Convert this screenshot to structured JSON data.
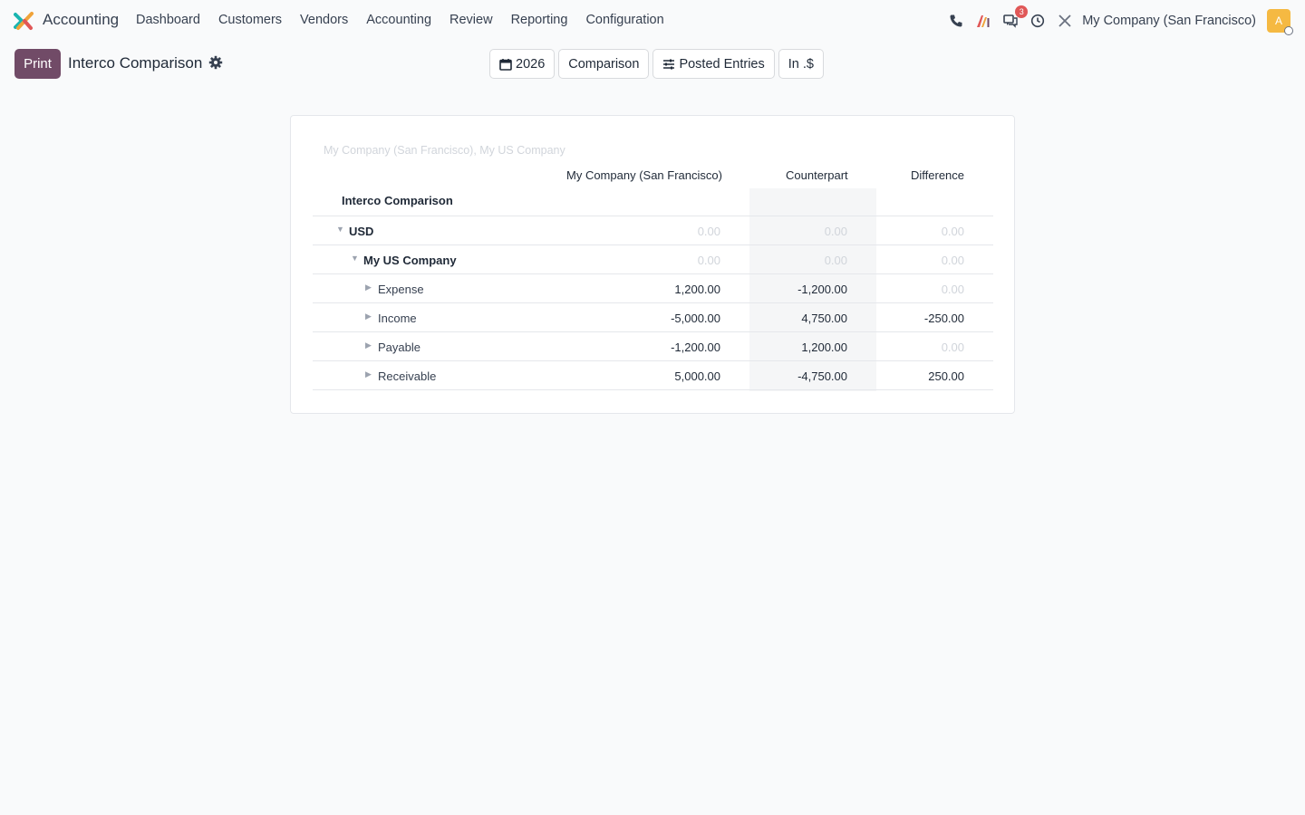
{
  "navbar": {
    "app_name": "Accounting",
    "menu": [
      "Dashboard",
      "Customers",
      "Vendors",
      "Accounting",
      "Review",
      "Reporting",
      "Configuration"
    ],
    "messages_badge": "3",
    "company": "My Company (San Francisco)",
    "avatar_letter": "A",
    "colors": {
      "brand": "#714b67",
      "avatar": "#f5b942",
      "badge": "#e05757"
    }
  },
  "control": {
    "print_label": "Print",
    "title": "Interco Comparison",
    "filters": {
      "date": "2026",
      "comparison": "Comparison",
      "posted": "Posted Entries",
      "currency": "In .$"
    }
  },
  "report": {
    "companies": "My Company (San Francisco), My US Company",
    "columns": [
      "My Company (San Francisco)",
      "Counterpart",
      "Difference"
    ],
    "section_title": "Interco Comparison",
    "rows": [
      {
        "label": "USD",
        "company": "0.00",
        "counterpart": "0.00",
        "difference": "0.00"
      },
      {
        "label": "My US Company",
        "company": "0.00",
        "counterpart": "0.00",
        "difference": "0.00"
      },
      {
        "label": "Expense",
        "company": "1,200.00",
        "counterpart": "-1,200.00",
        "difference": "0.00"
      },
      {
        "label": "Income",
        "company": "-5,000.00",
        "counterpart": "4,750.00",
        "difference": "-250.00"
      },
      {
        "label": "Payable",
        "company": "-1,200.00",
        "counterpart": "1,200.00",
        "difference": "0.00"
      },
      {
        "label": "Receivable",
        "company": "5,000.00",
        "counterpart": "-4,750.00",
        "difference": "250.00"
      }
    ]
  }
}
